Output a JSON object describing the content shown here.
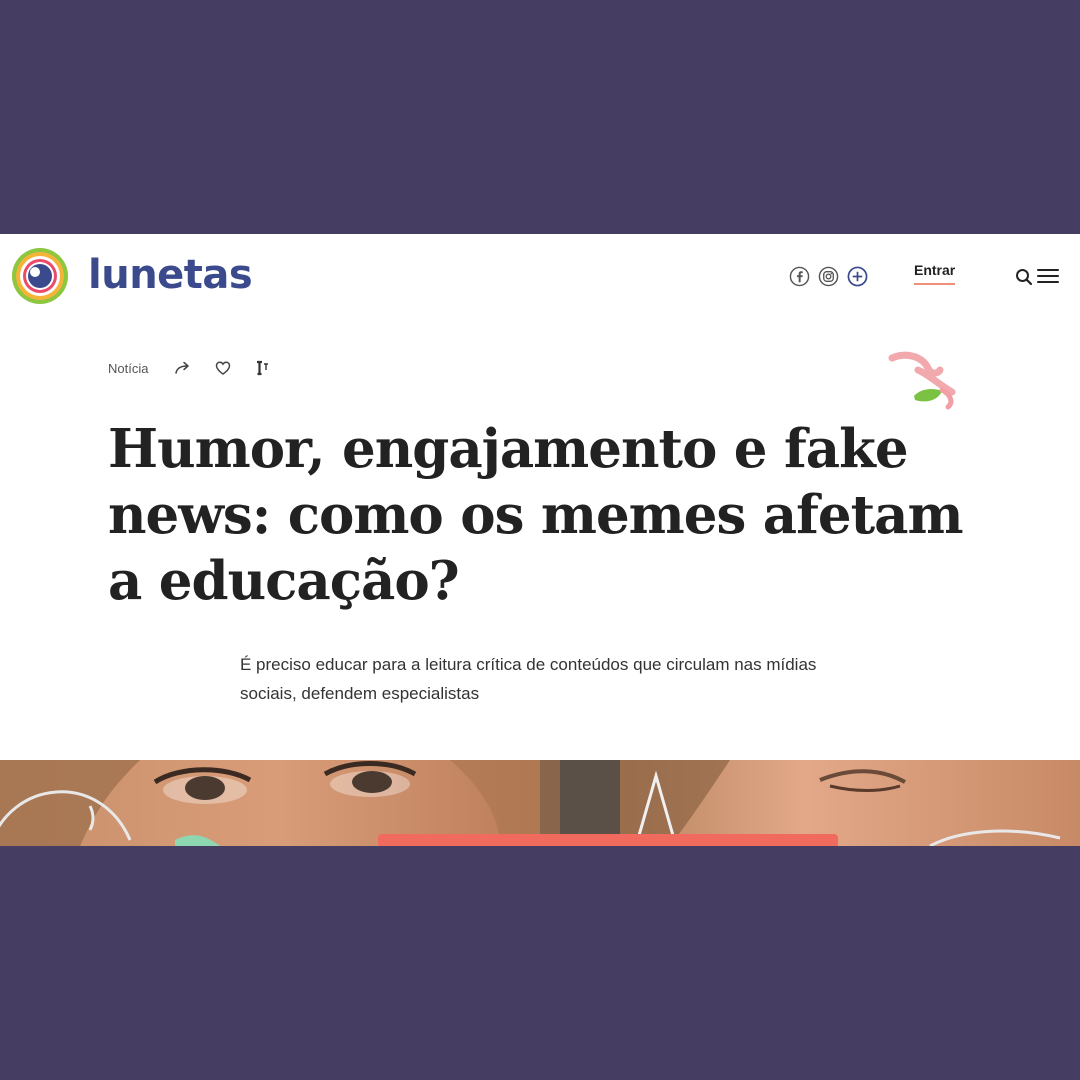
{
  "header": {
    "logo_text": "lunetas",
    "social_icons": [
      "facebook-icon",
      "instagram-icon",
      "plus-icon"
    ],
    "login_label": "Entrar",
    "accent_color": "#f0907a",
    "brand_color": "#3a4a8c"
  },
  "article": {
    "category": "Notícia",
    "actions": [
      "share-icon",
      "heart-icon",
      "text-size-icon"
    ],
    "headline": "Humor, engajamento e fake news: como os memes afetam a educação?",
    "subtitle": "É preciso educar para a leitura crítica de conteúdos que circulam nas mídias sociais, defendem especialistas"
  },
  "page": {
    "background_color": "#463e62"
  }
}
